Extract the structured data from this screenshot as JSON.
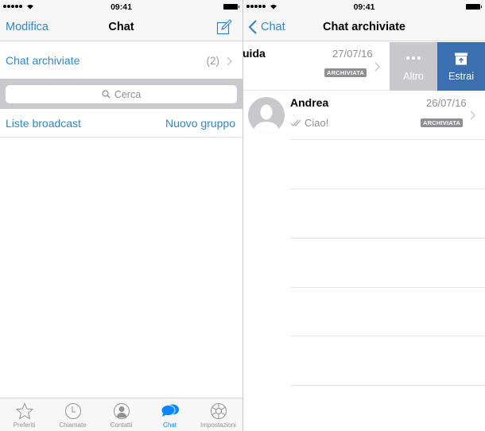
{
  "left_screen": {
    "status_bar": {
      "time": "09:41"
    },
    "nav": {
      "edit_label": "Modifica",
      "title": "Chat",
      "compose_icon": "compose-icon"
    },
    "archived_row": {
      "label": "Chat archiviate",
      "count": "(2)"
    },
    "search": {
      "placeholder": "Cerca"
    },
    "links": {
      "broadcast": "Liste broadcast",
      "new_group": "Nuovo gruppo"
    },
    "tabbar": {
      "active": "Chat",
      "tabs": [
        {
          "label": "Preferiti",
          "icon": "star-icon"
        },
        {
          "label": "Chiamate",
          "icon": "clock-icon"
        },
        {
          "label": "Contatti",
          "icon": "contact-icon"
        },
        {
          "label": "Chat",
          "icon": "chat-bubbles-icon"
        },
        {
          "label": "Impostazioni",
          "icon": "gear-icon"
        }
      ]
    }
  },
  "right_screen": {
    "status_bar": {
      "time": "09:41"
    },
    "nav": {
      "back_label": "Chat",
      "title": "Chat archiviate"
    },
    "chats": [
      {
        "name": "uida",
        "date": "27/07/16",
        "badge": "ARCHIVIATA",
        "swiped": true
      },
      {
        "name": "Andrea",
        "date": "26/07/16",
        "badge": "ARCHIVIATA",
        "last_message": "Ciao!",
        "read_receipt": "double-check"
      }
    ],
    "swipe_actions": [
      {
        "label": "Altro",
        "icon": "more-dots-icon",
        "color": "#c7c7cc"
      },
      {
        "label": "Estrai",
        "icon": "unarchive-icon",
        "color": "#3b6fb0"
      }
    ]
  },
  "colors": {
    "accent": "#2f86c8",
    "tab_active": "#0a84ff",
    "badge": "#8e8e93"
  }
}
